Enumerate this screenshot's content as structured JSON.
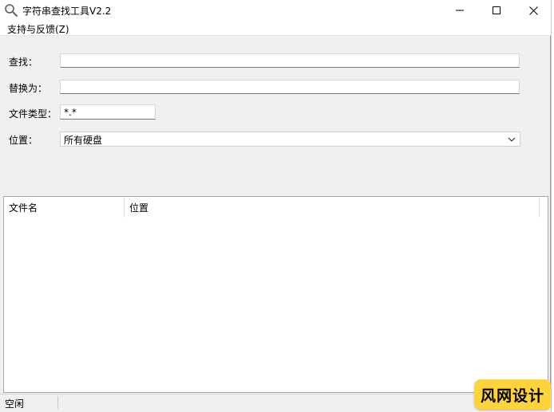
{
  "window": {
    "title": "字符串查找工具V2.2"
  },
  "titlebar_controls": {
    "minimize_icon": "minimize-icon",
    "maximize_icon": "maximize-icon",
    "close_icon": "close-icon"
  },
  "menu": {
    "items": [
      {
        "label": "支持与反馈(Z)"
      }
    ]
  },
  "form": {
    "find": {
      "label": "查找：",
      "value": ""
    },
    "replace": {
      "label": "替换为：",
      "value": ""
    },
    "filetype": {
      "label": "文件类型：",
      "value": "*.*"
    },
    "location": {
      "label": "位置：",
      "selected": "所有硬盘"
    }
  },
  "results": {
    "columns": [
      {
        "label": "文件名"
      },
      {
        "label": "位置"
      }
    ],
    "rows": []
  },
  "status": {
    "text": "空闲"
  },
  "watermark": {
    "text": "风网设计"
  },
  "colors": {
    "window_bg": "#f0f0f0",
    "titlebar_bg": "#ffffff",
    "watermark_bg": "#ffd33a"
  }
}
